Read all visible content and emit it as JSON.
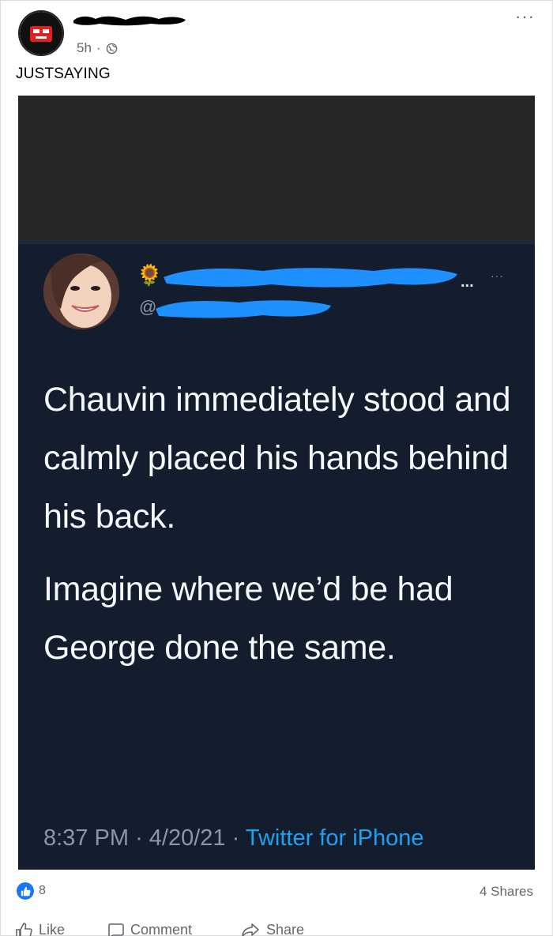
{
  "post": {
    "timestamp": "5h",
    "separator": "·",
    "caption": "JUSTSAYING",
    "more_label": "···"
  },
  "tweet": {
    "name_suffix": "...",
    "more_label": "···",
    "handle_prefix": "@",
    "paragraphs": [
      "Chauvin immediately stood and calmly placed his hands behind his back.",
      "Imagine where we’d be had George done the same."
    ],
    "time": "8:37 PM",
    "date": "4/20/21",
    "dot": "·",
    "source": "Twitter for iPhone"
  },
  "engagement": {
    "like_count": "8",
    "shares": "4 Shares"
  },
  "actions": {
    "like": "Like",
    "comment": "Comment",
    "share": "Share"
  },
  "colors": {
    "facebook_blue": "#1877f2",
    "twitter_blue": "#1da1f2",
    "tweet_bg": "#141d2e",
    "redaction_blue": "#1e90ff"
  },
  "icons": {
    "globe": "globe-icon",
    "like": "thumbs-up-icon",
    "comment": "comment-icon",
    "share": "share-icon",
    "sunflower": "sunflower-icon"
  }
}
